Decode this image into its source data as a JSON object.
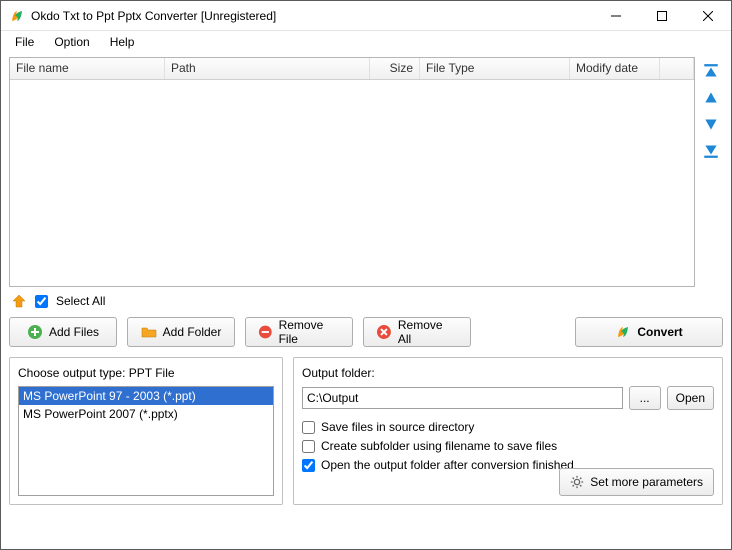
{
  "window": {
    "title": "Okdo Txt to Ppt Pptx Converter [Unregistered]"
  },
  "menu": {
    "file": "File",
    "option": "Option",
    "help": "Help"
  },
  "table": {
    "headers": {
      "filename": "File name",
      "path": "Path",
      "size": "Size",
      "filetype": "File Type",
      "modify": "Modify date"
    }
  },
  "selectAll": {
    "label": "Select All",
    "checked": true
  },
  "buttons": {
    "addFiles": "Add Files",
    "addFolder": "Add Folder",
    "removeFile": "Remove File",
    "removeAll": "Remove All",
    "convert": "Convert",
    "browse": "...",
    "open": "Open",
    "moreParams": "Set more parameters"
  },
  "outputType": {
    "label": "Choose output type:  PPT File",
    "options": [
      {
        "text": "MS PowerPoint 97 - 2003 (*.ppt)",
        "selected": true
      },
      {
        "text": "MS PowerPoint 2007 (*.pptx)",
        "selected": false
      }
    ]
  },
  "outputFolder": {
    "label": "Output folder:",
    "value": "C:\\Output"
  },
  "checks": {
    "saveInSource": {
      "label": "Save files in source directory",
      "checked": false
    },
    "createSubfolder": {
      "label": "Create subfolder using filename to save files",
      "checked": false
    },
    "openAfter": {
      "label": "Open the output folder after conversion finished",
      "checked": true
    }
  }
}
